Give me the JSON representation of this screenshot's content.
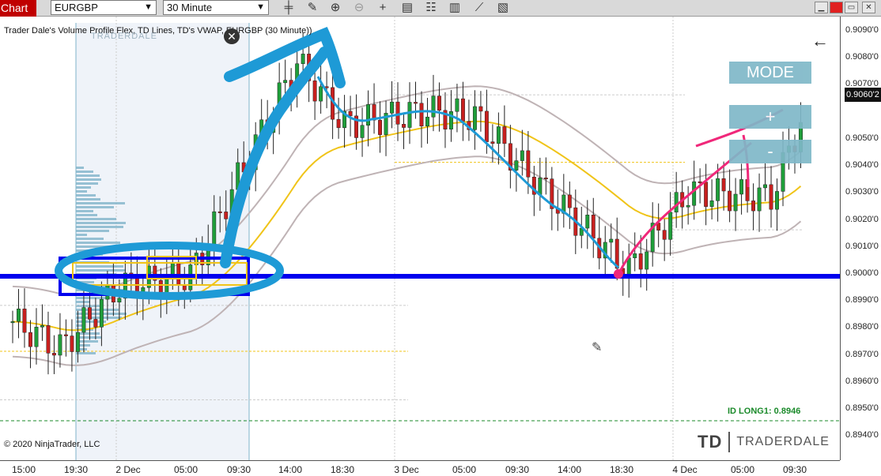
{
  "toolbar": {
    "chart_tab": "Chart",
    "instrument": "EURGBP",
    "interval": "30 Minute",
    "icons": [
      "bar-style-icon",
      "pencil-icon",
      "zoom-in-icon",
      "zoom-out-icon",
      "crosshair-icon",
      "data-box-icon",
      "properties-icon",
      "strategies-icon",
      "drawing-tools-icon",
      "template-icon"
    ]
  },
  "chart": {
    "title": "Trader Dale's Volume Profile Flex, TD Lines, TD's VWAP, EURGBP (30 Minute))",
    "copyright": "© 2020 NinjaTrader, LLC",
    "logo_text": "TRADERDALE",
    "logo_mark": "TD",
    "vp_watermark": "TRADERDALE",
    "long_label": "ID LONG1: 0.8946",
    "mode_button": "MODE",
    "plus_button": "+",
    "minus_button": "-",
    "back_arrow": "←",
    "current_price": "0.9060'2",
    "close_symbol": "✕",
    "colors": {
      "up_candle": "#1f9e3a",
      "down_candle": "#c8201f",
      "vwap": "#f0c419",
      "bands": "#bfb3b5",
      "level": "#0000ee",
      "annotation_blue": "#1e9ad6",
      "annotation_pink": "#f0287a",
      "profile": "#7fb3c9"
    }
  },
  "price_axis": [
    "0.9090'0",
    "0.9080'0",
    "0.9070'0",
    "0.9060'2",
    "0.9050'0",
    "0.9040'0",
    "0.9030'0",
    "0.9020'0",
    "0.9010'0",
    "0.9000'0",
    "0.8990'0",
    "0.8980'0",
    "0.8970'0",
    "0.8960'0",
    "0.8950'0",
    "0.8940'0"
  ],
  "time_axis": [
    "15:00",
    "19:30",
    "2 Dec",
    "05:00",
    "09:30",
    "14:00",
    "18:30",
    "3 Dec",
    "05:00",
    "09:30",
    "14:00",
    "18:30",
    "4 Dec",
    "05:00",
    "09:30"
  ]
}
